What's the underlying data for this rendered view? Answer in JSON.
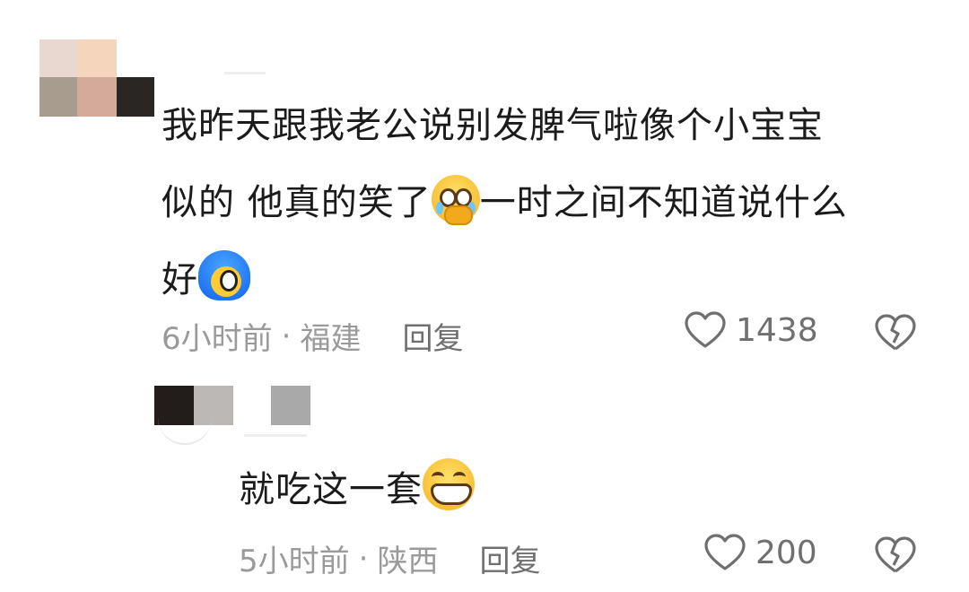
{
  "comments": [
    {
      "text_lines": [
        "我昨天跟我老公说别发脾气啦像个小宝宝",
        "似的 他真的笑了",
        "一时之间不知道说什么",
        "好"
      ],
      "time": "6小时前",
      "location": "福建",
      "reply_label": "回复",
      "likes": "1438",
      "emojis": [
        "crying-face-with-hands-over-mouth-emoji",
        "blue-hair-blushing-face-emoji"
      ]
    },
    {
      "text": "就吃这一套",
      "time": "5小时前",
      "location": "陕西",
      "reply_label": "回复",
      "likes": "200",
      "emojis": [
        "grinning-face-emoji"
      ]
    }
  ],
  "separator": "·",
  "icons": [
    "heart-outline-icon",
    "broken-heart-icon"
  ],
  "colors": {
    "text": "#1b1b1b",
    "meta": "#9a9a9a",
    "action": "#6f6f6f"
  }
}
